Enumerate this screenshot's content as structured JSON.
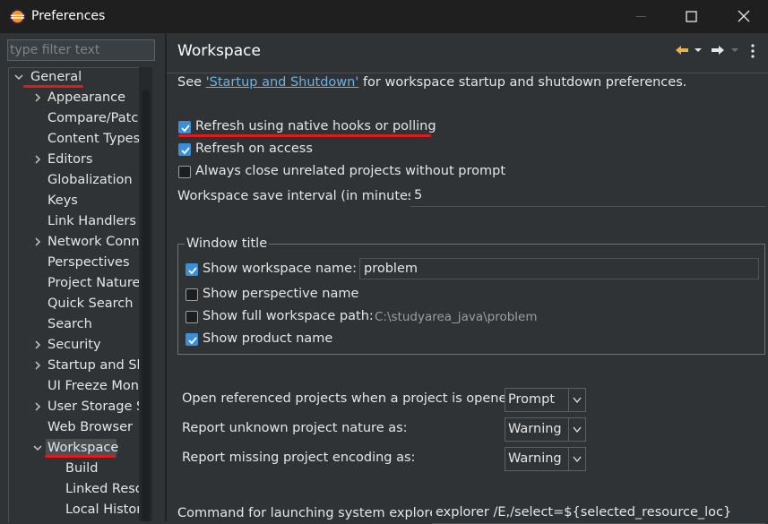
{
  "window": {
    "title": "Preferences"
  },
  "filter": {
    "placeholder": "type filter text"
  },
  "tree": [
    {
      "label": "General",
      "level": 0,
      "expander": "expanded"
    },
    {
      "label": "Appearance",
      "level": 1,
      "expander": "collapsed"
    },
    {
      "label": "Compare/Patch",
      "level": 1,
      "expander": "none"
    },
    {
      "label": "Content Types",
      "level": 1,
      "expander": "none"
    },
    {
      "label": "Editors",
      "level": 1,
      "expander": "collapsed"
    },
    {
      "label": "Globalization",
      "level": 1,
      "expander": "none"
    },
    {
      "label": "Keys",
      "level": 1,
      "expander": "none"
    },
    {
      "label": "Link Handlers",
      "level": 1,
      "expander": "none"
    },
    {
      "label": "Network Connections",
      "level": 1,
      "expander": "collapsed"
    },
    {
      "label": "Perspectives",
      "level": 1,
      "expander": "none"
    },
    {
      "label": "Project Natures",
      "level": 1,
      "expander": "none"
    },
    {
      "label": "Quick Search",
      "level": 1,
      "expander": "none"
    },
    {
      "label": "Search",
      "level": 1,
      "expander": "none"
    },
    {
      "label": "Security",
      "level": 1,
      "expander": "collapsed"
    },
    {
      "label": "Startup and Shutdown",
      "level": 1,
      "expander": "collapsed"
    },
    {
      "label": "UI Freeze Monitoring",
      "level": 1,
      "expander": "none"
    },
    {
      "label": "User Storage Service",
      "level": 1,
      "expander": "collapsed"
    },
    {
      "label": "Web Browser",
      "level": 1,
      "expander": "none"
    },
    {
      "label": "Workspace",
      "level": 1,
      "expander": "expanded",
      "selected": true
    },
    {
      "label": "Build",
      "level": 2,
      "expander": "none"
    },
    {
      "label": "Linked Resources",
      "level": 2,
      "expander": "none"
    },
    {
      "label": "Local History",
      "level": 2,
      "expander": "none"
    }
  ],
  "page": {
    "title": "Workspace",
    "see_prefix": "See ",
    "see_link": "'Startup and Shutdown'",
    "see_suffix": " for workspace startup and shutdown preferences.",
    "options": [
      {
        "label": "Refresh using native hooks or polling",
        "checked": true
      },
      {
        "label": "Refresh on access",
        "checked": true
      },
      {
        "label": "Always close unrelated projects without prompt",
        "checked": false
      }
    ],
    "save_interval_label": "Workspace save interval (in minutes):",
    "save_interval_value": "5",
    "window_title": {
      "legend": "Window title",
      "show_workspace_name": {
        "label": "Show workspace name:",
        "checked": true,
        "value": "problem"
      },
      "show_perspective_name": {
        "label": "Show perspective name",
        "checked": false
      },
      "show_full_path": {
        "label": "Show full workspace path:",
        "checked": false,
        "value": "C:\\studyarea_java\\problem"
      },
      "show_product_name": {
        "label": "Show product name",
        "checked": true
      }
    },
    "combos": [
      {
        "label": "Open referenced projects when a project is opened:",
        "value": "Prompt"
      },
      {
        "label": "Report unknown project nature as:",
        "value": "Warning"
      },
      {
        "label": "Report missing project encoding as:",
        "value": "Warning"
      }
    ],
    "explorer_label": "Command for launching system explorer:",
    "explorer_value": "explorer /E,/select=${selected_resource_loc}"
  },
  "colors": {
    "accent": "#3b8fd9",
    "highlight": "#e11a1a",
    "link": "#6fb0e0"
  }
}
